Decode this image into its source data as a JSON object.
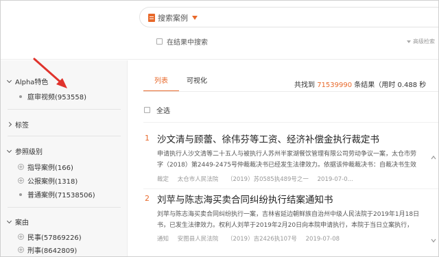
{
  "search": {
    "type_label": "搜索案例",
    "within_label": "在结果中搜索",
    "advanced_label": "高级检索"
  },
  "sidebar": {
    "alpha": {
      "title": "Alpha特色",
      "items": [
        {
          "label": "庭审视频(953558)"
        }
      ]
    },
    "tags": {
      "title": "标签"
    },
    "ref_level": {
      "title": "参照级别",
      "items": [
        {
          "label": "指导案例(166)"
        },
        {
          "label": "公报案例(1318)"
        },
        {
          "label": "普通案例(71538506)"
        }
      ]
    },
    "cause": {
      "title": "案由",
      "items": [
        {
          "label": "民事(57869226)"
        },
        {
          "label": "刑事(8642809)"
        }
      ]
    }
  },
  "main": {
    "tabs": [
      {
        "label": "列表"
      },
      {
        "label": "可视化"
      }
    ],
    "stats": {
      "prefix": "共找到",
      "count": "71539990",
      "suffix": "条结果（用时 0.488 秒"
    },
    "select_all": "全选",
    "results": [
      {
        "num": "1",
        "title": "沙文清与顾蕾、徐伟芬等工资、经济补偿金执行裁定书",
        "snippet1": "申请执行人沙文清等二十五人与被执行人苏州半家湖餐饮管理有限公司劳动争议一案，太仓市劳",
        "snippet2": "字（2018）第2449-2475号仲裁裁决书已经发生法律效力。依据该仲裁裁决书：自裁决书生效",
        "meta": [
          "裁定",
          "太仓市人民法院",
          "（2019）苏0585执489号之一",
          "2019-07-0..."
        ]
      },
      {
        "num": "2",
        "title": "刘苹与陈志海买卖合同纠纷执行结案通知书",
        "snippet1": "刘苹与陈志海买卖合同纠纷执行一案，吉林省延边朝鲜族自治州中级人民法院于2019年1月18日",
        "snippet2": "书，已发生法律效力。权利人刘苹于2019年2月20日向本院申请执行，本院于当日立案执行，",
        "meta": [
          "通知",
          "安图县人民法院",
          "（2019）吉2426执107号",
          "2019-07-08"
        ]
      }
    ]
  },
  "colors": {
    "accent": "#e8692b",
    "annotation_arrow": "#e0332c"
  }
}
